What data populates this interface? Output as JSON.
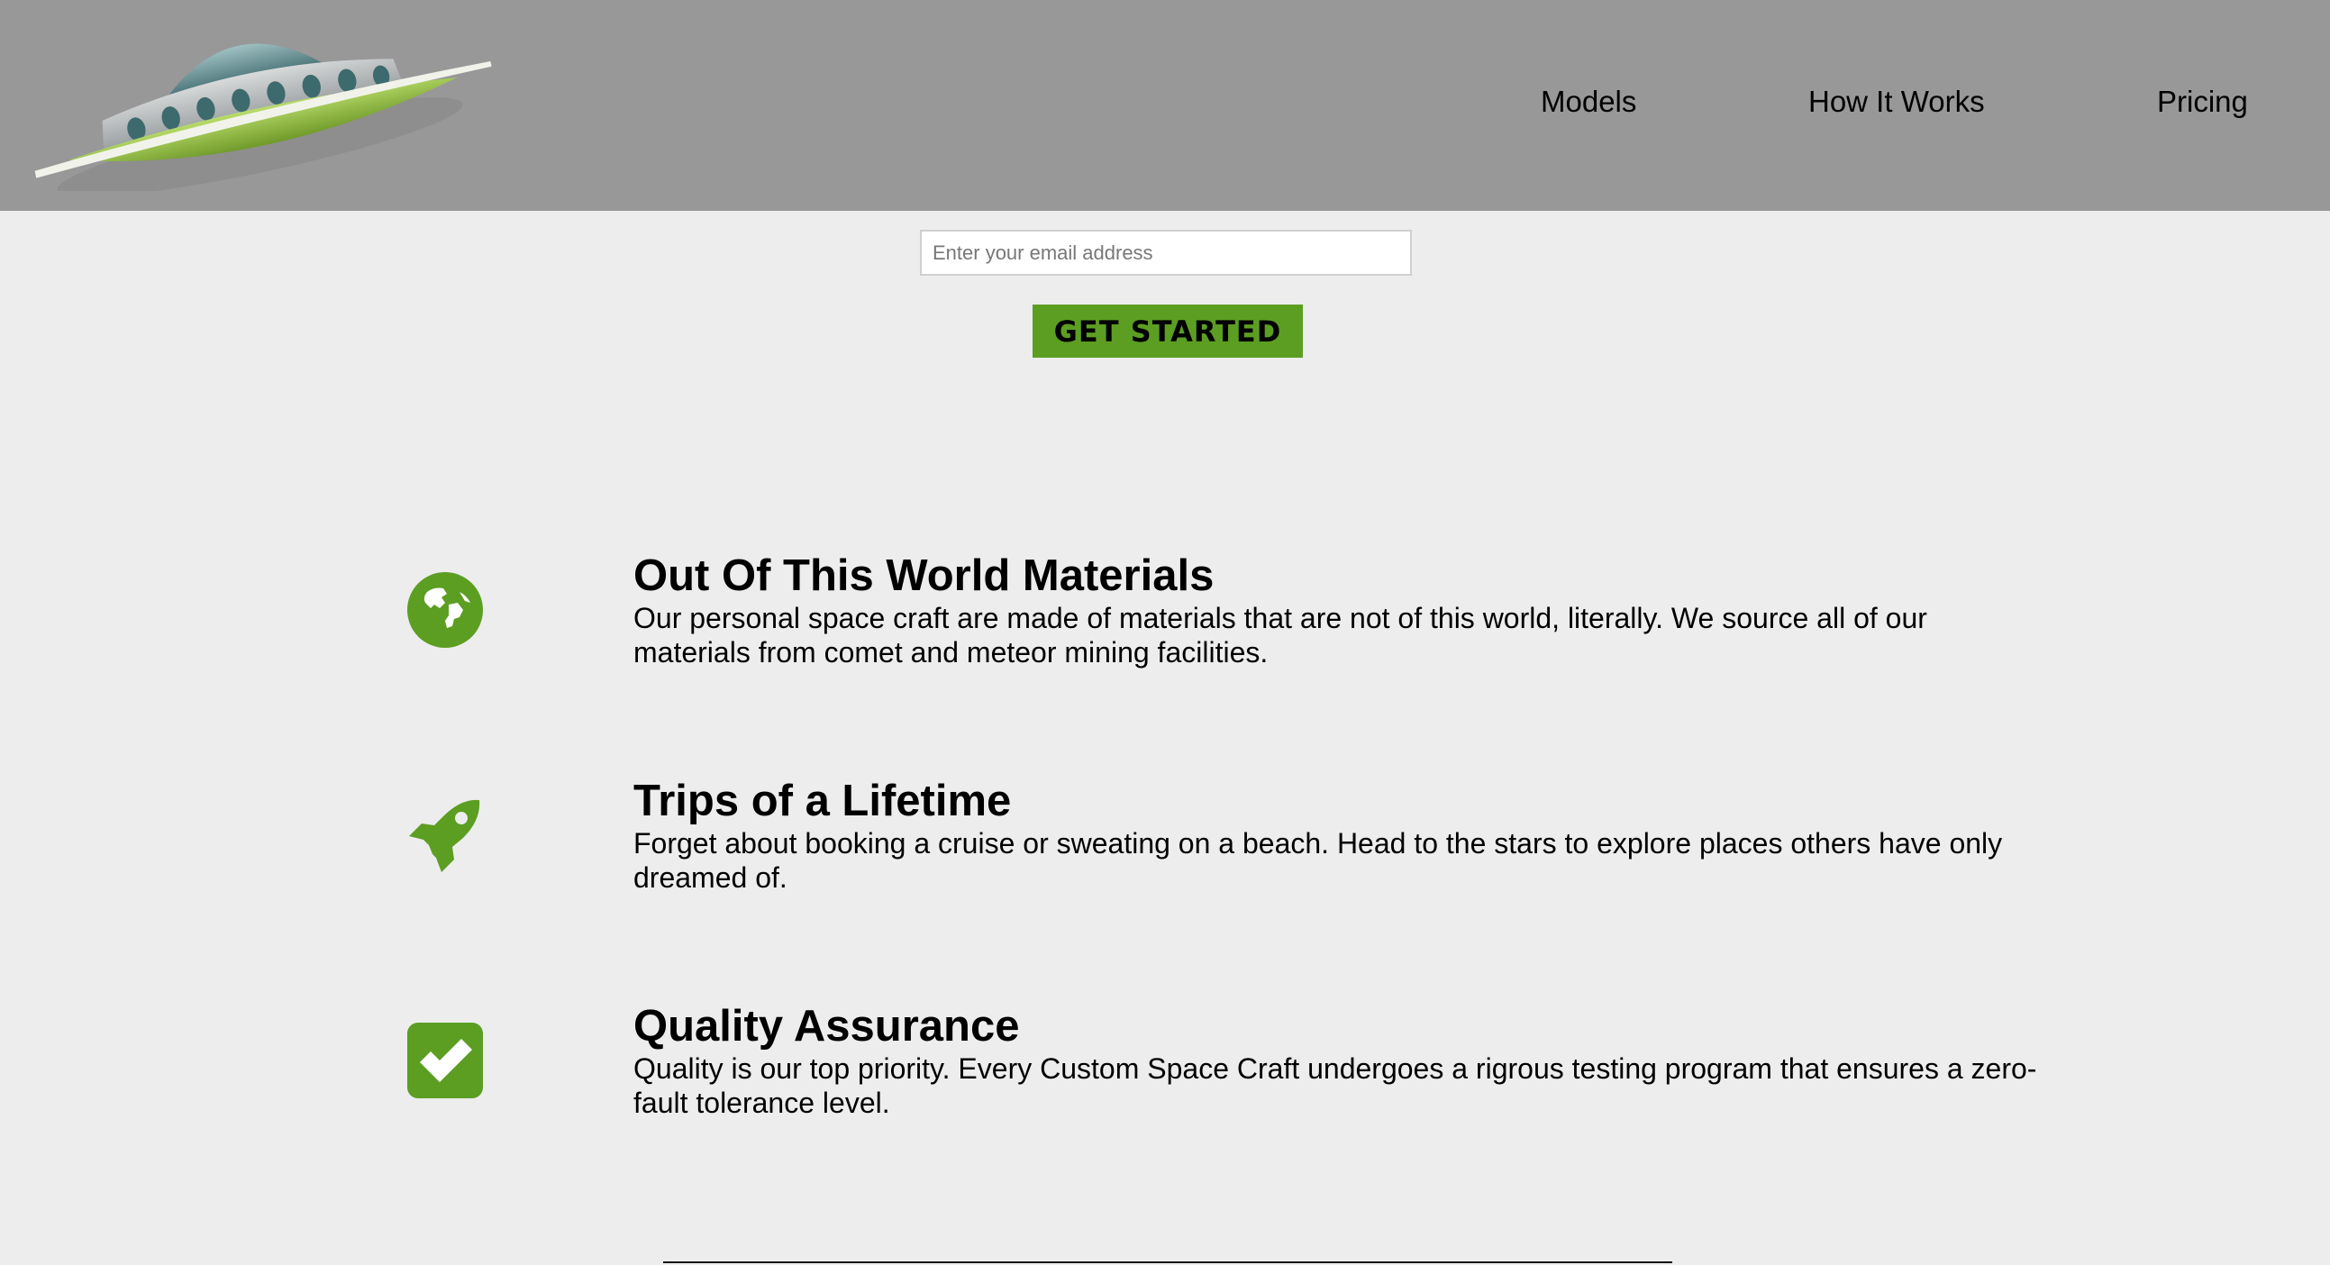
{
  "header": {
    "logo_icon": "ufo-spaceship-icon",
    "nav": [
      {
        "label": "Models"
      },
      {
        "label": "How It Works"
      },
      {
        "label": "Pricing"
      }
    ]
  },
  "signup": {
    "email_placeholder": "Enter your email address",
    "button_label": "GET STARTED"
  },
  "features": [
    {
      "icon": "globe-icon",
      "title": "Out Of This World Materials",
      "description": "Our personal space craft are made of materials that are not of this world, literally. We source all of our materials from comet and meteor mining facilities."
    },
    {
      "icon": "rocket-icon",
      "title": "Trips of a Lifetime",
      "description": "Forget about booking a cruise or sweating on a beach. Head to the stars to explore places others have only dreamed of."
    },
    {
      "icon": "checkbox-icon",
      "title": "Quality Assurance",
      "description": "Quality is our top priority. Every Custom Space Craft undergoes a rigrous testing program that ensures a zero-fault tolerance level."
    }
  ],
  "colors": {
    "header_bg": "#989898",
    "page_bg": "#ededed",
    "accent_green": "#5c9e22"
  }
}
